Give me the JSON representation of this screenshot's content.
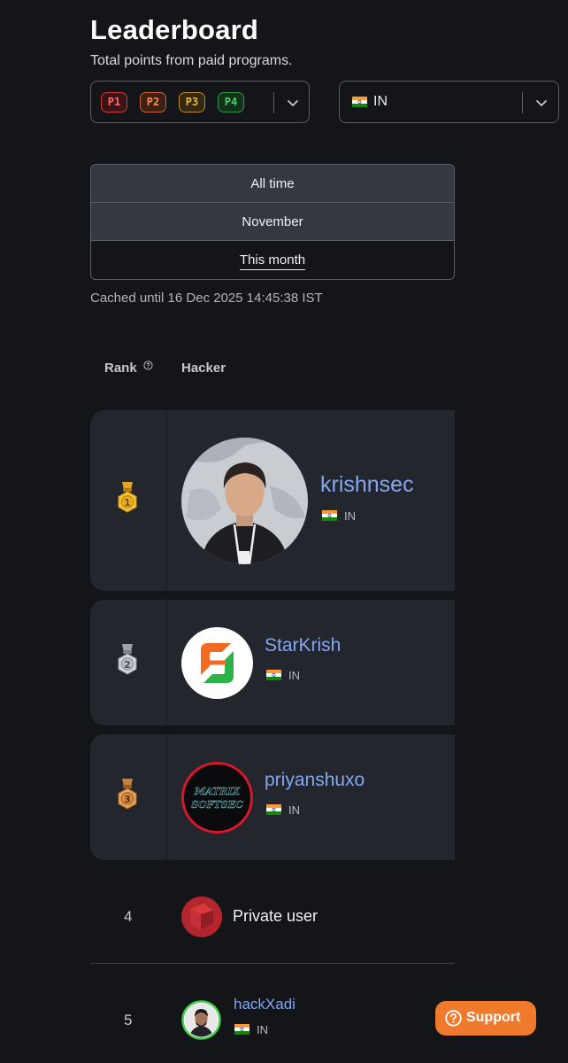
{
  "header": {
    "title": "Leaderboard",
    "subtitle": "Total points from paid programs."
  },
  "filters": {
    "severities": [
      "P1",
      "P2",
      "P3",
      "P4"
    ],
    "severity_colors": [
      "#ff6a6a",
      "#ff8a4a",
      "#f0b540",
      "#4fd06a"
    ],
    "country": {
      "flag": "india-flag-icon",
      "label": "IN"
    }
  },
  "period_options": [
    "All time",
    "November",
    "This month"
  ],
  "selected_period": "This month",
  "cached_text": "Cached until 16 Dec 2025 14:45:38 IST",
  "table": {
    "rank_header": "Rank",
    "hacker_header": "Hacker"
  },
  "rows": [
    {
      "rank": "1",
      "medal": "gold-medal-icon",
      "name": "krishnsec",
      "country": "IN",
      "avatar": "photo-avatar"
    },
    {
      "rank": "2",
      "medal": "silver-medal-icon",
      "name": "StarKrish",
      "country": "IN",
      "avatar": "orange-green-logo-avatar"
    },
    {
      "rank": "3",
      "medal": "bronze-medal-icon",
      "name": "priyanshuxo",
      "country": "IN",
      "avatar": "matrix-logo-avatar",
      "avatar_text": [
        "MATRIX",
        "SOFTSEC"
      ]
    },
    {
      "rank": "4",
      "name": "Private user",
      "avatar": "private-user-avatar"
    },
    {
      "rank": "5",
      "name": "hackXadi",
      "country": "IN",
      "avatar": "photo-avatar"
    }
  ],
  "support": {
    "label": "Support"
  },
  "colors": {
    "background": "#131519",
    "card": "#24262d",
    "username": "#84a7f0",
    "support": "#f07a2b"
  }
}
